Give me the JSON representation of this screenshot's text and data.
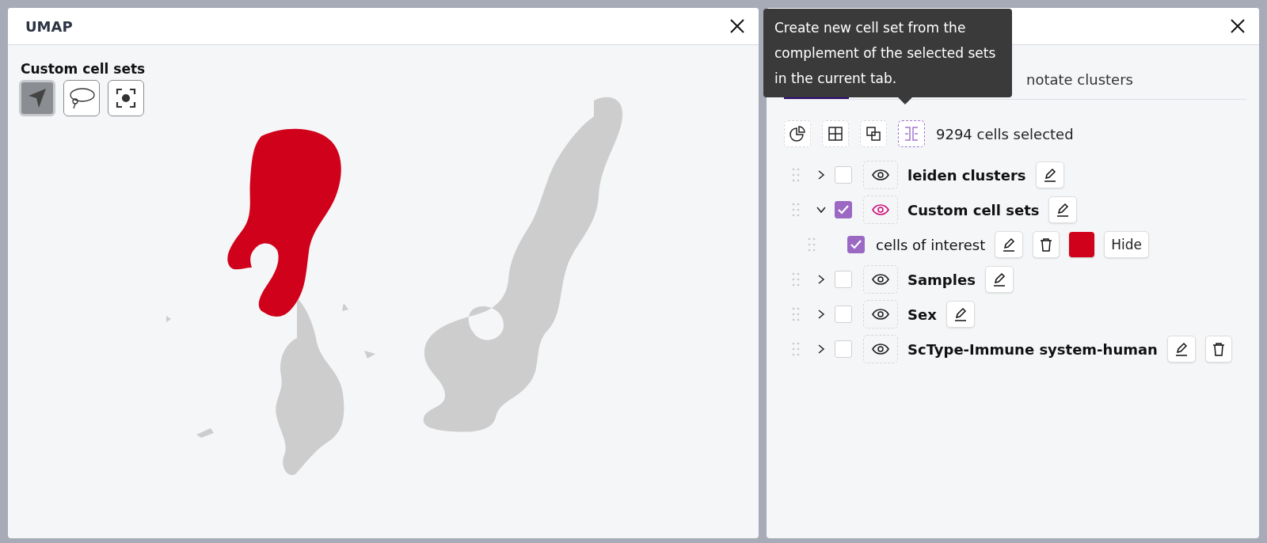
{
  "left_panel": {
    "title": "UMAP",
    "toolbar_label": "Custom cell sets",
    "tools": [
      {
        "kind": "pointer",
        "selected": true
      },
      {
        "kind": "lasso",
        "selected": false
      },
      {
        "kind": "focus",
        "selected": false
      }
    ]
  },
  "right_panel": {
    "tabs": [
      {
        "selected": true
      },
      {
        "label": "notate clusters",
        "selected": false
      }
    ],
    "actions": [
      {
        "kind": "pie",
        "highlighted": false
      },
      {
        "kind": "split",
        "highlighted": false
      },
      {
        "kind": "intersect",
        "highlighted": false
      },
      {
        "kind": "complement",
        "highlighted": true
      }
    ],
    "selection_count": "9294 cells selected",
    "tree": [
      {
        "label": "leiden clusters",
        "expanded": false,
        "checked": false,
        "visible": false,
        "deletable": false
      },
      {
        "label": "Custom cell sets",
        "expanded": true,
        "checked": true,
        "visible": true,
        "deletable": false,
        "children": [
          {
            "label": "cells of interest",
            "checked": true,
            "color": "#d0021b",
            "toggle": "Hide"
          }
        ]
      },
      {
        "label": "Samples",
        "expanded": false,
        "checked": false,
        "visible": false,
        "deletable": false
      },
      {
        "label": "Sex",
        "expanded": false,
        "checked": false,
        "visible": false,
        "deletable": false
      },
      {
        "label": "ScType-Immune system-human",
        "expanded": false,
        "checked": false,
        "visible": false,
        "deletable": true
      }
    ]
  },
  "tooltip": {
    "text": "Create new cell set from the complement of the selected sets in the current tab."
  }
}
